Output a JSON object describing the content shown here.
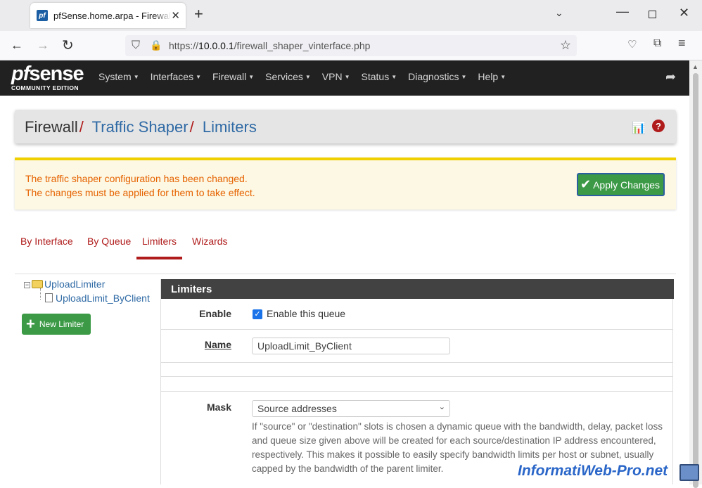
{
  "browser": {
    "tab_title": "pfSense.home.arpa - Firewall: Traffic Shaper: Limiters",
    "favicon_text": "pf",
    "url_prefix": "https://",
    "url_host": "10.0.0.1",
    "url_path": "/firewall_shaper_vinterface.php"
  },
  "pfsense": {
    "logo_word_pf": "pf",
    "logo_word_sense": "sense",
    "logo_sub": "COMMUNITY EDITION",
    "menu": [
      "System",
      "Interfaces",
      "Firewall",
      "Services",
      "VPN",
      "Status",
      "Diagnostics",
      "Help"
    ]
  },
  "breadcrumb": {
    "first": "Firewall",
    "sep": "/",
    "second": "Traffic Shaper",
    "third": "Limiters"
  },
  "alert": {
    "line1": "The traffic shaper configuration has been changed.",
    "line2": "The changes must be applied for them to take effect.",
    "apply_label": "Apply Changes"
  },
  "tabs": [
    "By Interface",
    "By Queue",
    "Limiters",
    "Wizards"
  ],
  "active_tab": "Limiters",
  "tree": {
    "parent": "UploadLimiter",
    "child": "UploadLimit_ByClient"
  },
  "new_limiter_label": "New Limiter",
  "panel": {
    "title": "Limiters",
    "enable_label": "Enable",
    "enable_checkbox_label": "Enable this queue",
    "enable_checked": true,
    "name_label": "Name",
    "name_value": "UploadLimit_ByClient",
    "mask_label": "Mask",
    "mask_value": "Source addresses",
    "mask_help": "If \"source\" or \"destination\" slots is chosen a dynamic queue with the bandwidth, delay, packet loss and queue size given above will be created for each source/destination IP address encountered, respectively. This makes it possible to easily specify bandwidth limits per host or subnet, usually capped by the bandwidth of the parent limiter."
  },
  "watermark": "InformatiWeb-Pro.net",
  "colors": {
    "brand_red": "#b01b1b",
    "link_blue": "#2f6aa5",
    "success_green": "#3c9a46",
    "warning_text": "#e66200",
    "nav_dark": "#212121"
  }
}
